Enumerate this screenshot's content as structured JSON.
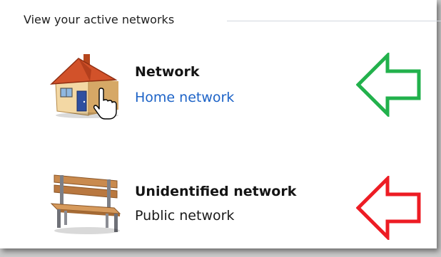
{
  "section": {
    "title": "View your active networks"
  },
  "networks": [
    {
      "name": "Network",
      "type": "Home network",
      "icon": "home-icon",
      "type_is_link": true
    },
    {
      "name": "Unidentified network",
      "type": "Public network",
      "icon": "bench-icon",
      "type_is_link": false
    }
  ],
  "annotations": {
    "arrow_1_color": "#22b14c",
    "arrow_2_color": "#ed1c24"
  },
  "colors": {
    "link": "#1d63c7",
    "header_rule": "#d3d8de"
  }
}
